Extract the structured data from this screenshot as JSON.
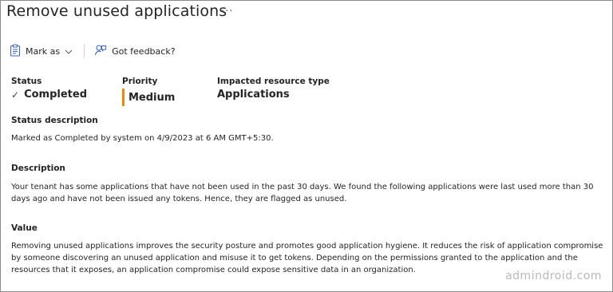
{
  "page": {
    "title": "Remove unused applications",
    "more_label": "···"
  },
  "toolbar": {
    "mark_as_label": "Mark as",
    "feedback_label": "Got feedback?"
  },
  "properties": {
    "status_key": "Status",
    "status_value": "Completed",
    "priority_key": "Priority",
    "priority_value": "Medium",
    "priority_color": "#e8890c",
    "resource_key": "Impacted resource type",
    "resource_value": "Applications"
  },
  "status_description": {
    "heading": "Status description",
    "text": "Marked as Completed by system on 4/9/2023 at 6 AM GMT+5:30."
  },
  "description": {
    "heading": "Description",
    "text": "Your tenant has some applications that have not been used in the past 30 days. We found the following applications were last used more than 30 days ago and have not been issued any tokens. Hence, they are flagged as unused."
  },
  "value": {
    "heading": "Value",
    "text": "Removing unused applications improves the security posture and promotes good application hygiene. It reduces the risk of application compromise by someone discovering an unused application and misuse it to get tokens. Depending on the permissions granted to the application and the resources that it exposes, an application compromise could expose sensitive data in an organization."
  },
  "watermark": "admindroid.com"
}
